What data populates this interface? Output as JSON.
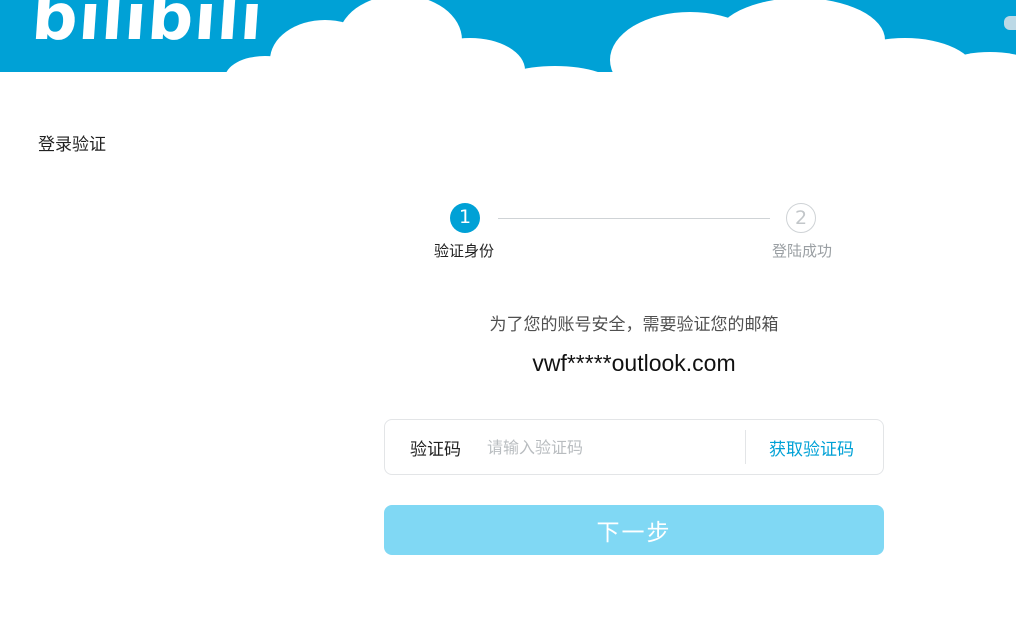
{
  "header": {
    "logo_text": "bilibili",
    "brand_color": "#00a1d6",
    "cloud_color": "#ffffff"
  },
  "page": {
    "title": "登录验证"
  },
  "steps": [
    {
      "number": "1",
      "label": "验证身份",
      "state": "active"
    },
    {
      "number": "2",
      "label": "登陆成功",
      "state": "inactive"
    }
  ],
  "verify": {
    "notice": "为了您的账号安全，需要验证您的邮箱",
    "email": "vwf*****outlook.com"
  },
  "code_field": {
    "label": "验证码",
    "placeholder": "请输入验证码",
    "value": "",
    "get_code_label": "获取验证码"
  },
  "actions": {
    "next_label": "下一步",
    "next_color": "#80d8f4"
  }
}
